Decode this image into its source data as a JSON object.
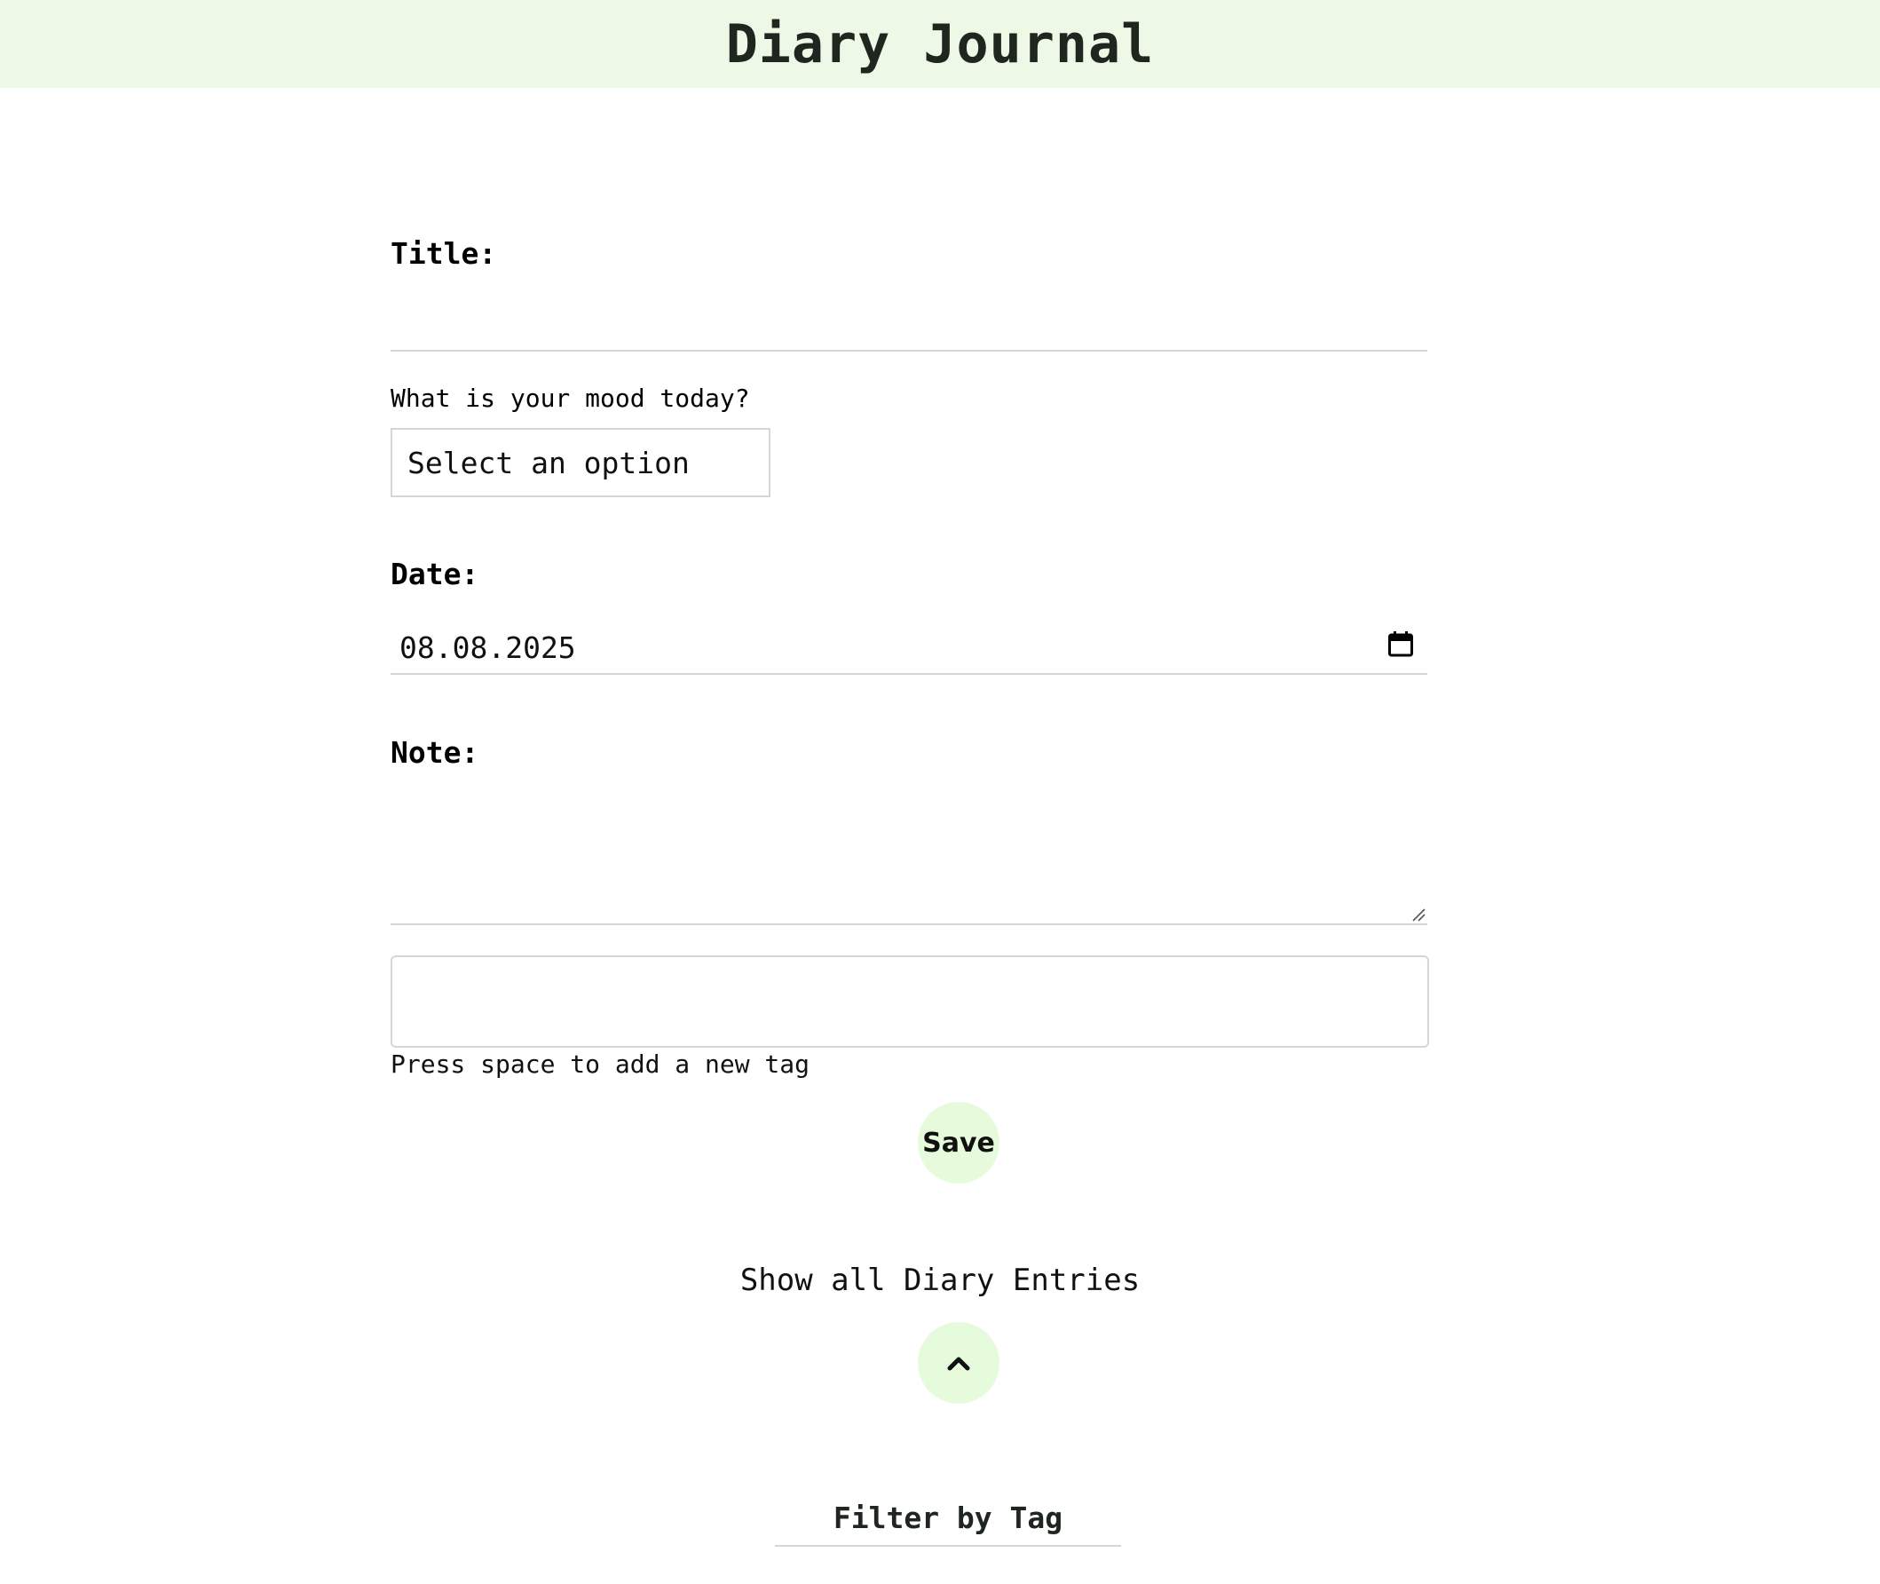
{
  "header": {
    "title": "Diary Journal",
    "background": "#edf8e7"
  },
  "form": {
    "title_label": "Title:",
    "title_value": "",
    "mood_label": "What is your mood today?",
    "mood_selected": "Select an option",
    "date_label": "Date:",
    "date_value": "08.08.2025",
    "note_label": "Note:",
    "note_value": "",
    "tags_value": "",
    "tags_hint": "Press space to add a new tag",
    "save_label": "Save"
  },
  "entries": {
    "show_all_label": "Show all Diary Entries",
    "toggle_icon": "chevron-up-icon",
    "filter_label": "Filter by Tag"
  },
  "colors": {
    "accent": "#e5fbdc",
    "border": "#d6d6d6"
  }
}
